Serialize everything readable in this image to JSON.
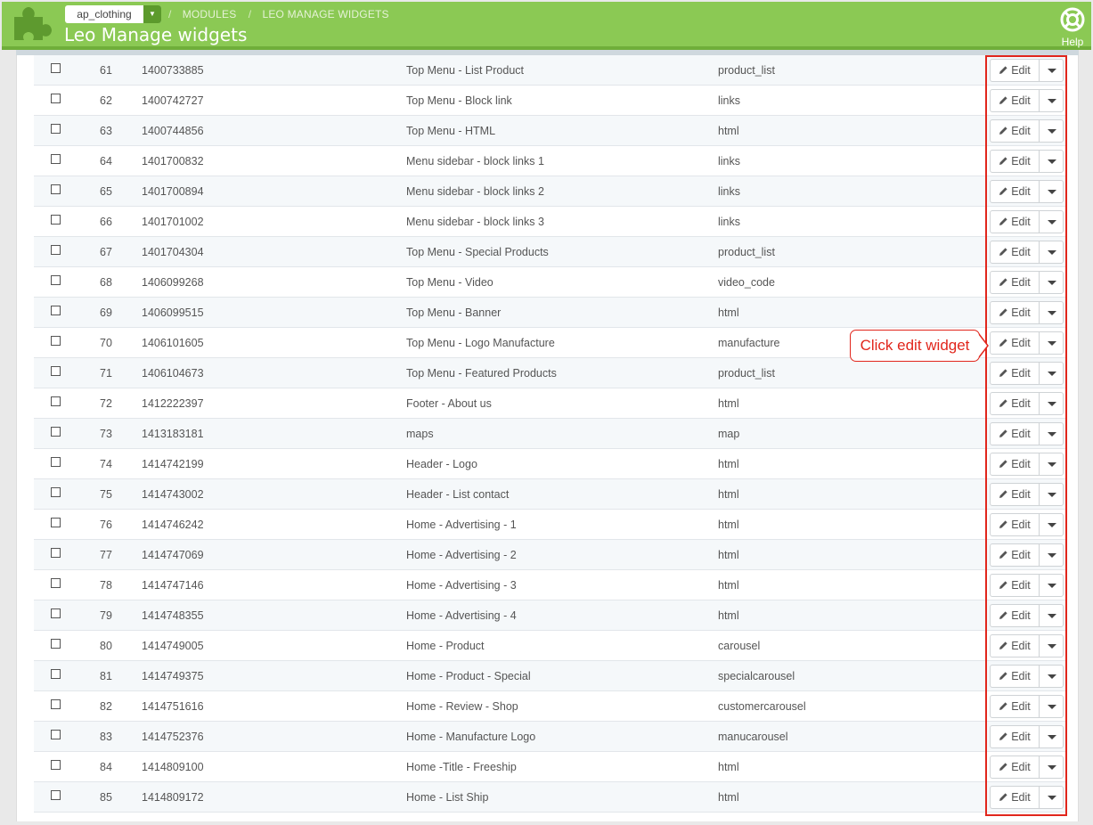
{
  "header": {
    "shop_selector": "ap_clothing",
    "breadcrumb": [
      "MODULES",
      "LEO MANAGE WIDGETS"
    ],
    "title": "Leo Manage widgets",
    "help_label": "Help",
    "brand_color": "#8bc954"
  },
  "table": {
    "edit_label": "Edit",
    "rows": [
      {
        "id": "61",
        "key": "1400733885",
        "name": "Top Menu - List Product",
        "type": "product_list"
      },
      {
        "id": "62",
        "key": "1400742727",
        "name": "Top Menu - Block link",
        "type": "links"
      },
      {
        "id": "63",
        "key": "1400744856",
        "name": "Top Menu - HTML",
        "type": "html"
      },
      {
        "id": "64",
        "key": "1401700832",
        "name": "Menu sidebar - block links 1",
        "type": "links"
      },
      {
        "id": "65",
        "key": "1401700894",
        "name": "Menu sidebar - block links 2",
        "type": "links"
      },
      {
        "id": "66",
        "key": "1401701002",
        "name": "Menu sidebar - block links 3",
        "type": "links"
      },
      {
        "id": "67",
        "key": "1401704304",
        "name": "Top Menu - Special Products",
        "type": "product_list"
      },
      {
        "id": "68",
        "key": "1406099268",
        "name": "Top Menu - Video",
        "type": "video_code"
      },
      {
        "id": "69",
        "key": "1406099515",
        "name": "Top Menu - Banner",
        "type": "html"
      },
      {
        "id": "70",
        "key": "1406101605",
        "name": "Top Menu - Logo Manufacture",
        "type": "manufacture"
      },
      {
        "id": "71",
        "key": "1406104673",
        "name": "Top Menu - Featured Products",
        "type": "product_list"
      },
      {
        "id": "72",
        "key": "1412222397",
        "name": "Footer - About us",
        "type": "html"
      },
      {
        "id": "73",
        "key": "1413183181",
        "name": "maps",
        "type": "map"
      },
      {
        "id": "74",
        "key": "1414742199",
        "name": "Header - Logo",
        "type": "html"
      },
      {
        "id": "75",
        "key": "1414743002",
        "name": "Header - List contact",
        "type": "html"
      },
      {
        "id": "76",
        "key": "1414746242",
        "name": "Home - Advertising - 1",
        "type": "html"
      },
      {
        "id": "77",
        "key": "1414747069",
        "name": "Home - Advertising - 2",
        "type": "html"
      },
      {
        "id": "78",
        "key": "1414747146",
        "name": "Home - Advertising - 3",
        "type": "html"
      },
      {
        "id": "79",
        "key": "1414748355",
        "name": "Home - Advertising - 4",
        "type": "html"
      },
      {
        "id": "80",
        "key": "1414749005",
        "name": "Home - Product",
        "type": "carousel"
      },
      {
        "id": "81",
        "key": "1414749375",
        "name": "Home - Product - Special",
        "type": "specialcarousel"
      },
      {
        "id": "82",
        "key": "1414751616",
        "name": "Home - Review - Shop",
        "type": "customercarousel"
      },
      {
        "id": "83",
        "key": "1414752376",
        "name": "Home - Manufacture Logo",
        "type": "manucarousel"
      },
      {
        "id": "84",
        "key": "1414809100",
        "name": "Home -Title - Freeship",
        "type": "html"
      },
      {
        "id": "85",
        "key": "1414809172",
        "name": "Home - List Ship",
        "type": "html"
      }
    ]
  },
  "annotation": {
    "callout_text": "Click edit widget",
    "color": "#e1261c"
  }
}
